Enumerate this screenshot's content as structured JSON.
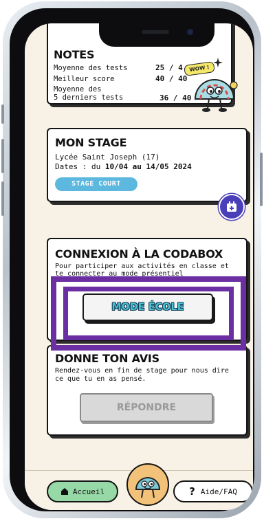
{
  "notes": {
    "title": "NOTES",
    "rows": [
      {
        "label": "Moyenne des tests",
        "value": "25 / 4"
      },
      {
        "label": "Meilleur score",
        "value": "40 / 40"
      },
      {
        "label_line1": "Moyenne des",
        "label_line2": "5 derniers tests",
        "value": "36 / 40"
      }
    ],
    "wow_badge": "WOW !"
  },
  "stage": {
    "title": "MON STAGE",
    "school": "Lycée Saint Joseph (17)",
    "dates_prefix": "Dates : du ",
    "dates_value": "10/04 au 14/05 2024",
    "badge": "STAGE COURT",
    "calendar_icon": "calendar-plus-icon"
  },
  "codabox": {
    "title": "CONNEXION À LA CODABOX",
    "description": "Pour participer aux activités en classe et te connecter au mode présentiel",
    "button": "MODE ÉCOLE"
  },
  "avis": {
    "title": "DONNE TON AVIS",
    "description": "Rendez-vous en fin de stage pour nous dire ce que tu en as pensé.",
    "button": "RÉPONDRE"
  },
  "nav": {
    "home": {
      "label": "Accueil",
      "icon": "home-icon"
    },
    "help": {
      "label": "Aide/FAQ",
      "icon": "question-icon"
    },
    "center": {
      "icon": "mascot-avatar-icon"
    }
  },
  "colors": {
    "highlight": "#6c2fa3",
    "accent_blue": "#5cb8de",
    "accent_green": "#96d8a6",
    "calendar": "#4a3fb8"
  }
}
